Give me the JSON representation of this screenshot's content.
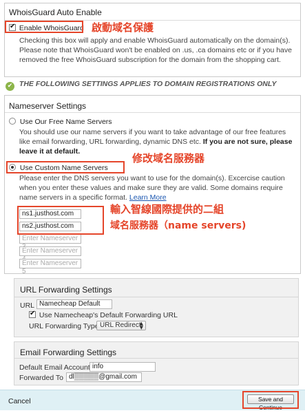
{
  "whoisguard": {
    "title": "WhoisGuard Auto Enable",
    "checkbox_label": "Enable WhoisGuard",
    "description": "Checking this box will apply and enable WhoisGuard automatically on the domain(s). Please note that WhoisGuard won't be enabled on .us, .ca domains etc or if you have removed the free WhoisGuard subscription for the domain from the shopping cart.",
    "annotation": "啟動域名保護"
  },
  "notice": {
    "text": "THE FOLLOWING SETTINGS APPLIES TO DOMAIN REGISTRATIONS ONLY"
  },
  "nameserver": {
    "title": "Nameserver Settings",
    "option1_label": "Use Our Free Name Servers",
    "option1_desc": "You should use our name servers if you want to take advantage of our free features like email forwarding, URL forwarding, dynamic DNS etc.",
    "option1_bold": "If you are not sure, please leave it at default.",
    "option2_label": "Use Custom Name Servers",
    "option2_desc": "Please enter the DNS servers you want to use for the domain(s). Excercise caution when you enter these values and make sure they are valid. Some domains require name servers in a specific format.",
    "learn_more": "Learn More",
    "ns1": "ns1.justhost.com",
    "ns2": "ns2.justhost.com",
    "ns3_placeholder": "Enter Nameserver 3",
    "ns4_placeholder": "Enter Nameserver 4",
    "ns5_placeholder": "Enter Nameserver 5",
    "annotation_custom": "修改域名服務器",
    "annotation_ns_line1": "輸入智線國際提供的二組",
    "annotation_ns_line2": "域名服務器（name servers)"
  },
  "url_forwarding": {
    "title": "URL Forwarding Settings",
    "url_label": "URL",
    "url_value": "Namecheap Default",
    "default_checkbox_label": "Use Namecheap's Default Forwarding URL",
    "type_label": "URL Forwarding Type",
    "type_value": "URL Redirect"
  },
  "email_forwarding": {
    "title": "Email Forwarding Settings",
    "default_account_label": "Default Email Account",
    "default_account_value": "info",
    "forwarded_to_label": "Forwarded To",
    "forwarded_to_value": "dl▒▒▒▒▒@gmail.com"
  },
  "footer": {
    "cancel": "Cancel",
    "save": "Save and Continue"
  },
  "colors": {
    "annotation_red": "#e5452a",
    "footer_bg": "#dff0f5",
    "link_blue": "#1a56b0",
    "notice_green": "#7aa33a"
  }
}
